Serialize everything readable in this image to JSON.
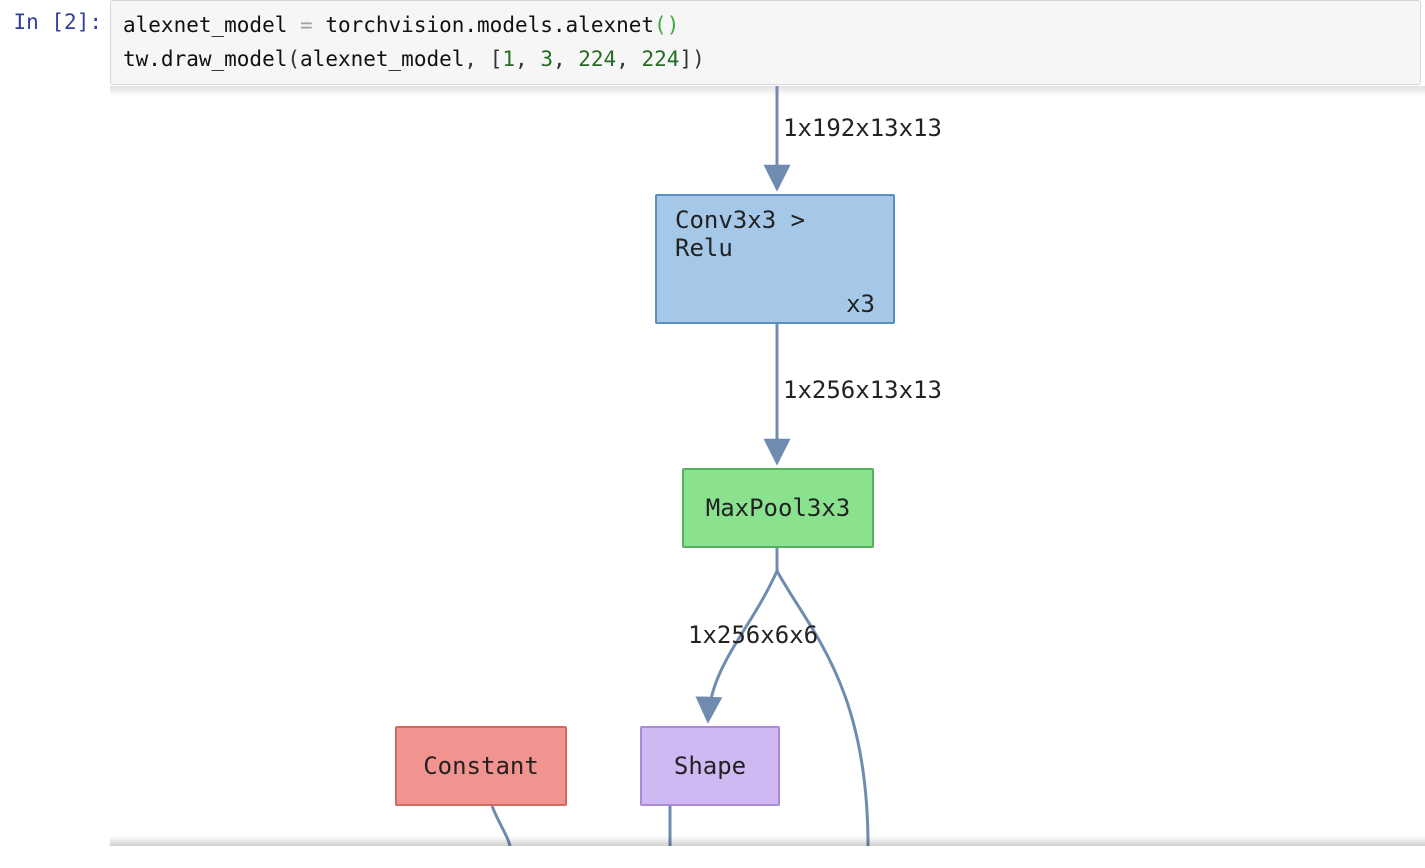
{
  "prompt": {
    "prefix": "In ",
    "open": "[",
    "number": "2",
    "close": "]",
    "colon": ":"
  },
  "code": {
    "assign_lhs": "alexnet_model",
    "assign_op": " = ",
    "models_path": "torchvision.models.alexnet",
    "paren_open": "(",
    "paren_close": ")",
    "line2_call": "tw.draw_model",
    "arg1": "alexnet_model",
    "comma": ", ",
    "lb": "[",
    "rb": "]",
    "n1": "1",
    "n2": "3",
    "n3": "224",
    "n4": "224"
  },
  "graph": {
    "edge_labels": {
      "in_top": "1x192x13x13",
      "conv_to_pool": "1x256x13x13",
      "pool_to_shape": "1x256x6x6"
    },
    "nodes": {
      "conv_label": "Conv3x3 > Relu",
      "conv_mult": "x3",
      "pool_label": "MaxPool3x3",
      "const_label": "Constant",
      "shape_label": "Shape"
    }
  }
}
